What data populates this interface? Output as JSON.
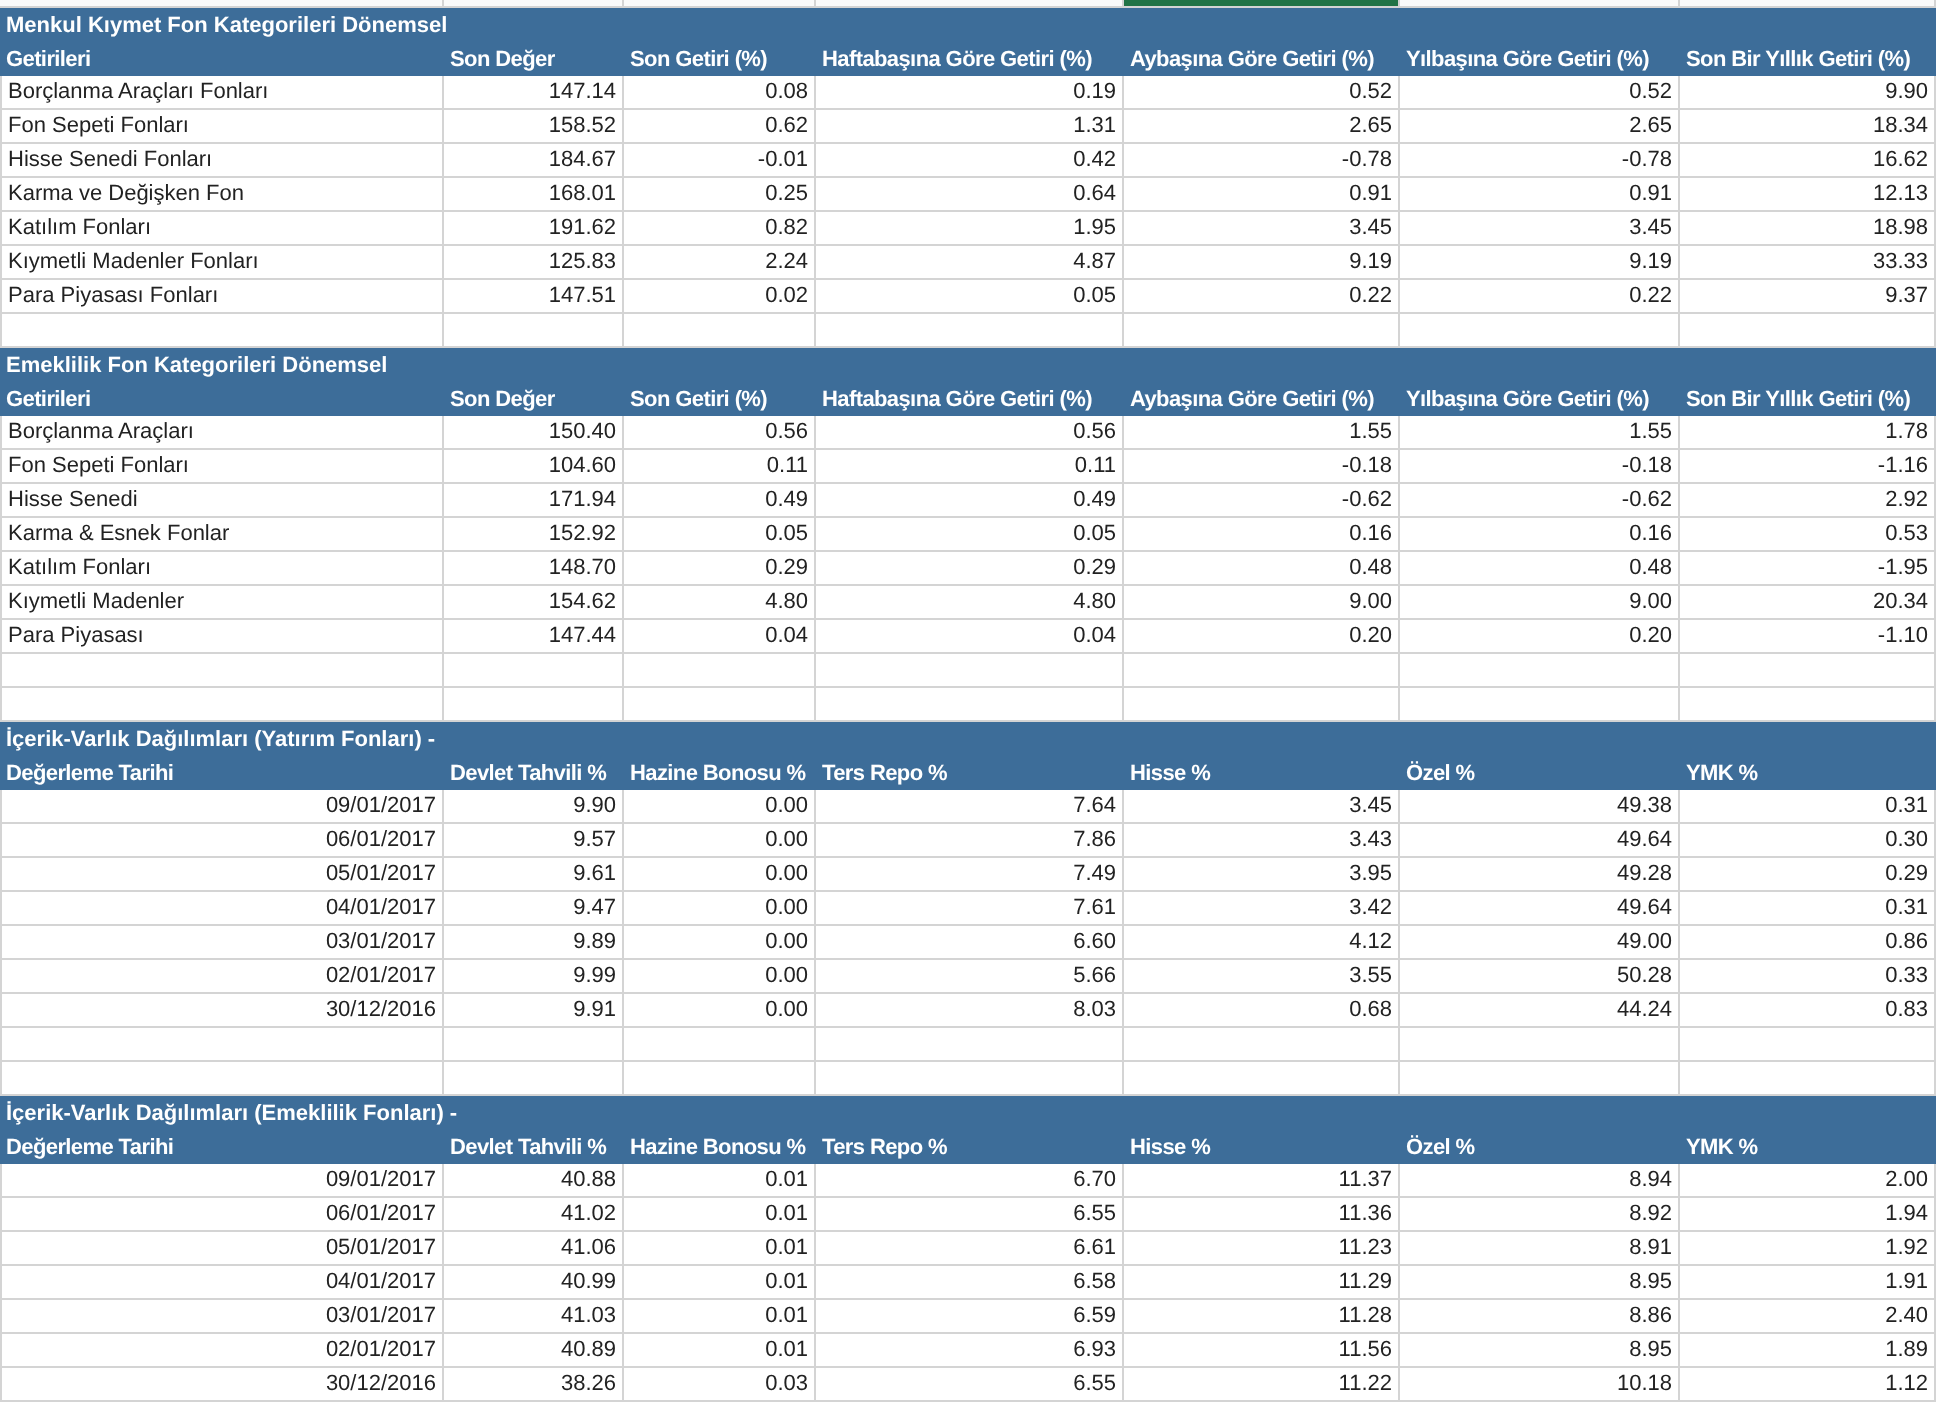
{
  "top_row": [
    {
      "selected": false
    },
    {
      "selected": false
    },
    {
      "selected": false
    },
    {
      "selected": false
    },
    {
      "selected": true
    },
    {
      "selected": false
    },
    {
      "selected": false
    }
  ],
  "sections": [
    {
      "kind": "category",
      "title": "Menkul Kıymet Fon Kategorileri Dönemsel",
      "columns": [
        "Getirileri",
        "Son Değer",
        "Son Getiri (%)",
        "Haftabaşına Göre Getiri (%)",
        "Aybaşına Göre Getiri (%)",
        "Yılbaşına Göre Getiri (%)",
        "Son Bir Yıllık Getiri (%)"
      ],
      "rows": [
        [
          "Borçlanma Araçları Fonları",
          "147.14",
          "0.08",
          "0.19",
          "0.52",
          "0.52",
          "9.90"
        ],
        [
          "Fon Sepeti Fonları",
          "158.52",
          "0.62",
          "1.31",
          "2.65",
          "2.65",
          "18.34"
        ],
        [
          "Hisse Senedi Fonları",
          "184.67",
          "-0.01",
          "0.42",
          "-0.78",
          "-0.78",
          "16.62"
        ],
        [
          "Karma ve Değişken Fon",
          "168.01",
          "0.25",
          "0.64",
          "0.91",
          "0.91",
          "12.13"
        ],
        [
          "Katılım Fonları",
          "191.62",
          "0.82",
          "1.95",
          "3.45",
          "3.45",
          "18.98"
        ],
        [
          "Kıymetli Madenler Fonları",
          "125.83",
          "2.24",
          "4.87",
          "9.19",
          "9.19",
          "33.33"
        ],
        [
          "Para Piyasası Fonları",
          "147.51",
          "0.02",
          "0.05",
          "0.22",
          "0.22",
          "9.37"
        ]
      ]
    },
    {
      "kind": "category",
      "title": "Emeklilik Fon Kategorileri Dönemsel",
      "columns": [
        "Getirileri",
        "Son Değer",
        "Son Getiri (%)",
        "Haftabaşına Göre Getiri (%)",
        "Aybaşına Göre Getiri (%)",
        "Yılbaşına Göre Getiri (%)",
        "Son Bir Yıllık Getiri (%)"
      ],
      "rows": [
        [
          "Borçlanma Araçları",
          "150.40",
          "0.56",
          "0.56",
          "1.55",
          "1.55",
          "1.78"
        ],
        [
          "Fon Sepeti Fonları",
          "104.60",
          "0.11",
          "0.11",
          "-0.18",
          "-0.18",
          "-1.16"
        ],
        [
          "Hisse Senedi",
          "171.94",
          "0.49",
          "0.49",
          "-0.62",
          "-0.62",
          "2.92"
        ],
        [
          "Karma & Esnek Fonlar",
          "152.92",
          "0.05",
          "0.05",
          "0.16",
          "0.16",
          "0.53"
        ],
        [
          "Katılım Fonları",
          "148.70",
          "0.29",
          "0.29",
          "0.48",
          "0.48",
          "-1.95"
        ],
        [
          "Kıymetli Madenler",
          "154.62",
          "4.80",
          "4.80",
          "9.00",
          "9.00",
          "20.34"
        ],
        [
          "Para Piyasası",
          "147.44",
          "0.04",
          "0.04",
          "0.20",
          "0.20",
          "-1.10"
        ]
      ]
    },
    {
      "kind": "dated",
      "title": "İçerik-Varlık Dağılımları (Yatırım Fonları) -",
      "columns": [
        "Değerleme Tarihi",
        "Devlet Tahvili %",
        "Hazine Bonosu %",
        "Ters Repo %",
        "Hisse %",
        "Özel %",
        "YMK %"
      ],
      "rows": [
        [
          "09/01/2017",
          "9.90",
          "0.00",
          "7.64",
          "3.45",
          "49.38",
          "0.31"
        ],
        [
          "06/01/2017",
          "9.57",
          "0.00",
          "7.86",
          "3.43",
          "49.64",
          "0.30"
        ],
        [
          "05/01/2017",
          "9.61",
          "0.00",
          "7.49",
          "3.95",
          "49.28",
          "0.29"
        ],
        [
          "04/01/2017",
          "9.47",
          "0.00",
          "7.61",
          "3.42",
          "49.64",
          "0.31"
        ],
        [
          "03/01/2017",
          "9.89",
          "0.00",
          "6.60",
          "4.12",
          "49.00",
          "0.86"
        ],
        [
          "02/01/2017",
          "9.99",
          "0.00",
          "5.66",
          "3.55",
          "50.28",
          "0.33"
        ],
        [
          "30/12/2016",
          "9.91",
          "0.00",
          "8.03",
          "0.68",
          "44.24",
          "0.83"
        ]
      ]
    },
    {
      "kind": "dated",
      "title": "İçerik-Varlık Dağılımları (Emeklilik Fonları) -",
      "columns": [
        "Değerleme Tarihi",
        "Devlet Tahvili %",
        "Hazine Bonosu %",
        "Ters Repo %",
        "Hisse %",
        "Özel %",
        "YMK %"
      ],
      "rows": [
        [
          "09/01/2017",
          "40.88",
          "0.01",
          "6.70",
          "11.37",
          "8.94",
          "2.00"
        ],
        [
          "06/01/2017",
          "41.02",
          "0.01",
          "6.55",
          "11.36",
          "8.92",
          "1.94"
        ],
        [
          "05/01/2017",
          "41.06",
          "0.01",
          "6.61",
          "11.23",
          "8.91",
          "1.92"
        ],
        [
          "04/01/2017",
          "40.99",
          "0.01",
          "6.58",
          "11.29",
          "8.95",
          "1.91"
        ],
        [
          "03/01/2017",
          "41.03",
          "0.01",
          "6.59",
          "11.28",
          "8.86",
          "2.40"
        ],
        [
          "02/01/2017",
          "40.89",
          "0.01",
          "6.93",
          "11.56",
          "8.95",
          "1.89"
        ],
        [
          "30/12/2016",
          "38.26",
          "0.03",
          "6.55",
          "11.22",
          "10.18",
          "1.12"
        ]
      ]
    }
  ]
}
